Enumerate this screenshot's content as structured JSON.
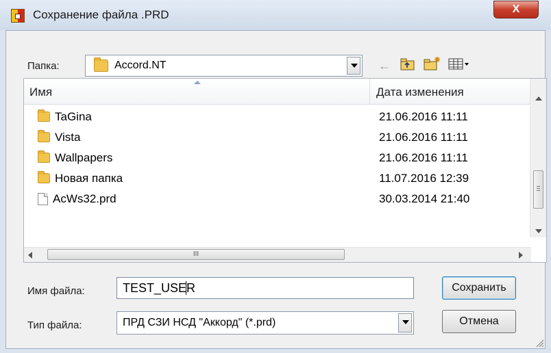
{
  "window": {
    "title": "Сохранение файла .PRD",
    "close_symbol": "X"
  },
  "folder_bar": {
    "label": "Папка:",
    "current": "Accord.NT"
  },
  "toolbar": {
    "back": "←"
  },
  "file_list": {
    "columns": [
      "Имя",
      "Дата изменения"
    ],
    "rows": [
      {
        "name": "TaGina",
        "date": "21.06.2016 11:11",
        "type": "folder"
      },
      {
        "name": "Vista",
        "date": "21.06.2016 11:11",
        "type": "folder"
      },
      {
        "name": "Wallpapers",
        "date": "21.06.2016 11:11",
        "type": "folder"
      },
      {
        "name": "Новая папка",
        "date": "11.07.2016 12:39",
        "type": "folder"
      },
      {
        "name": "AcWs32.prd",
        "date": "30.03.2014 21:40",
        "type": "file"
      }
    ],
    "scroll_grip": "III"
  },
  "filename": {
    "label": "Имя файла:",
    "value": "TEST_USER"
  },
  "filetype": {
    "label": "Тип файла:",
    "value": "ПРД СЗИ НСД \"Аккорд\" (*.prd)"
  },
  "buttons": {
    "save": "Сохранить",
    "cancel": "Отмена"
  }
}
